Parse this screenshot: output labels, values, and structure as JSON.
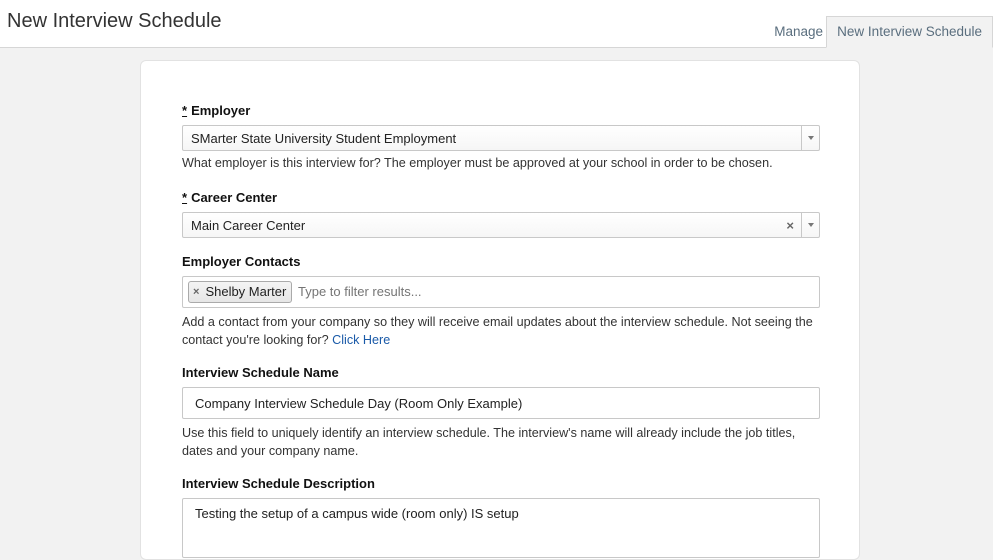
{
  "header": {
    "title": "New Interview Schedule",
    "tabs": [
      {
        "label": "Manage"
      },
      {
        "label": "New Interview Schedule",
        "active": true
      }
    ]
  },
  "form": {
    "employer": {
      "required_mark": "*",
      "label": "Employer",
      "value": "SMarter State University Student Employment",
      "help": "What employer is this interview for? The employer must be approved at your school in order to be chosen."
    },
    "career_center": {
      "required_mark": "*",
      "label": "Career Center",
      "value": "Main Career Center",
      "clear_glyph": "×"
    },
    "employer_contacts": {
      "label": "Employer Contacts",
      "chips": [
        {
          "label": "Shelby Marter",
          "remove_glyph": "×"
        }
      ],
      "placeholder": "Type to filter results...",
      "help": "Add a contact from your company so they will receive email updates about the interview schedule. Not seeing the contact you're looking for?",
      "help_link": "Click Here"
    },
    "schedule_name": {
      "label": "Interview Schedule Name",
      "value": "Company Interview Schedule Day (Room Only Example)",
      "help": "Use this field to uniquely identify an interview schedule. The interview's name will already include the job titles, dates and your company name."
    },
    "schedule_description": {
      "label": "Interview Schedule Description",
      "value": "Testing the setup of a campus wide (room only) IS setup"
    }
  },
  "colors": {
    "link": "#1a5aa8",
    "background": "#f2f2f2",
    "card": "#ffffff"
  }
}
